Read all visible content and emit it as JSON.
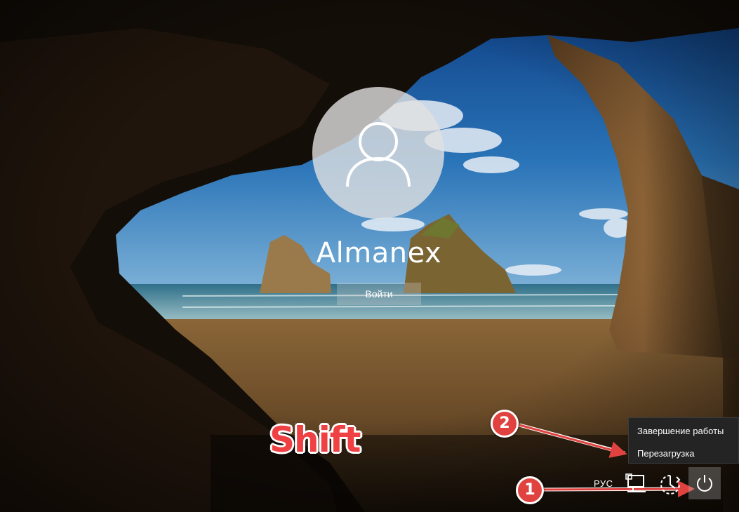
{
  "user": {
    "name": "Almanex",
    "sign_in_label": "Войти"
  },
  "annotation": {
    "key_label": "Shift",
    "step_1": "1",
    "step_2": "2",
    "color": "#e0433f"
  },
  "power_menu": {
    "items": [
      {
        "label": "Завершение работы"
      },
      {
        "label": "Перезагрузка"
      }
    ]
  },
  "tray": {
    "language": "РУС",
    "icons": [
      "network-icon",
      "ease-of-access-icon",
      "power-icon"
    ]
  }
}
